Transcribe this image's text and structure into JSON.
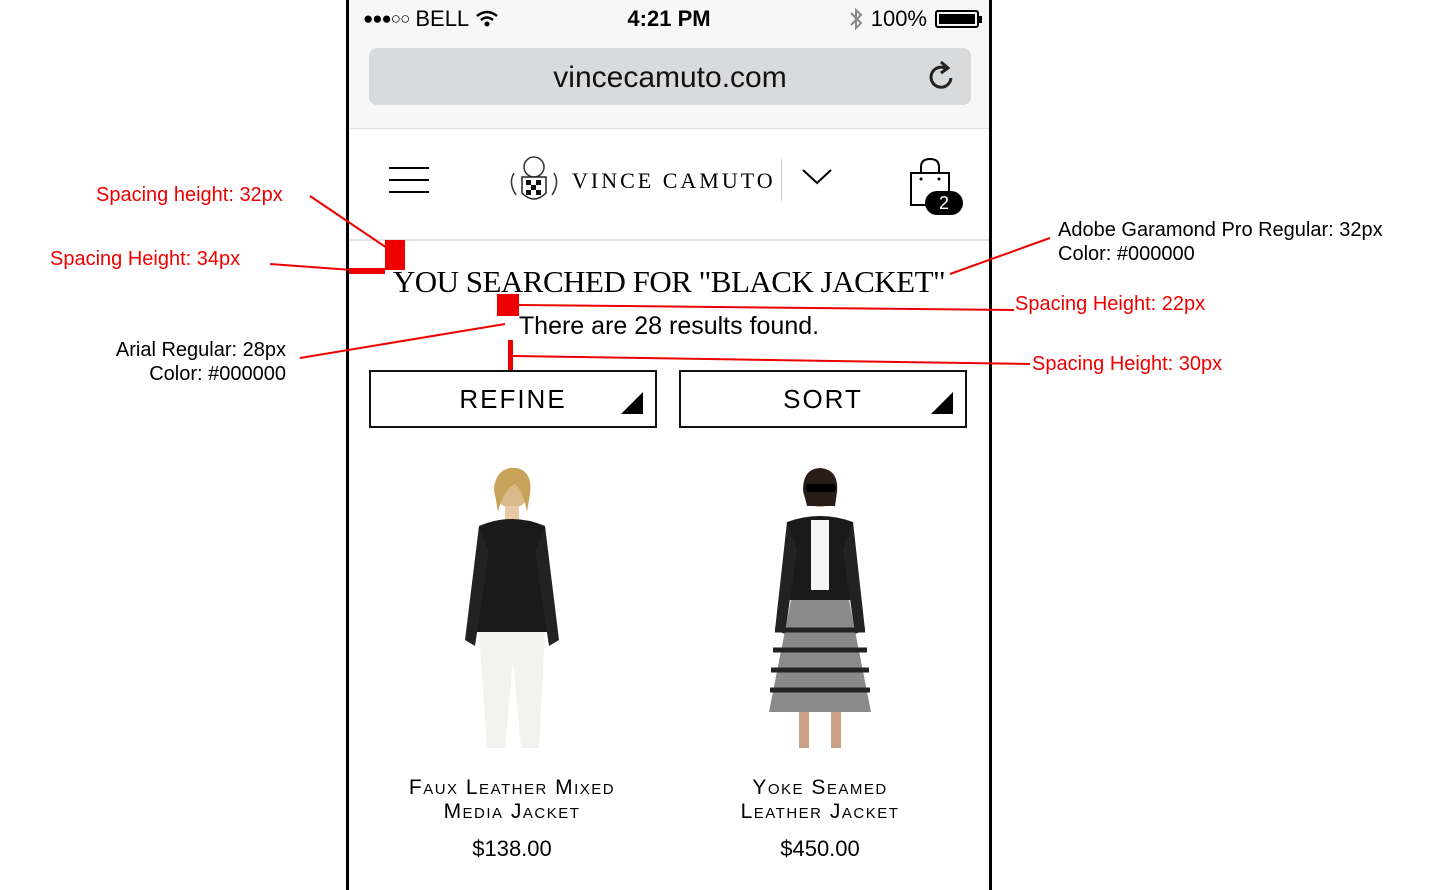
{
  "status_bar": {
    "carrier": "BELL",
    "signal_dots": "●●●○○",
    "time": "4:21 PM",
    "battery": "100%"
  },
  "browser": {
    "url": "vincecamuto.com"
  },
  "header": {
    "brand": "VINCE CAMUTO",
    "cart_count": "2"
  },
  "search": {
    "title": "YOU SEARCHED FOR \"BLACK JACKET\"",
    "count_text": "There are 28 results found."
  },
  "controls": {
    "refine_label": "REFINE",
    "sort_label": "SORT"
  },
  "products": [
    {
      "name_line1": "Faux Leather Mixed",
      "name_line2": "Media Jacket",
      "price": "$138.00"
    },
    {
      "name_line1": "Yoke Seamed",
      "name_line2": "Leather Jacket",
      "price": "$450.00"
    }
  ],
  "annotations": {
    "spacing_top": "Spacing height: 32px",
    "spacing_left": "Spacing Height: 34px",
    "spacing_22": "Spacing Height: 22px",
    "spacing_30": "Spacing Height: 30px",
    "title_font_line1": "Adobe Garamond Pro Regular: 32px",
    "title_font_line2": "Color: #000000",
    "body_font_line1": "Arial Regular: 28px",
    "body_font_line2": "Color: #000000"
  },
  "colors": {
    "annotation": "#e00000",
    "urlbar": "#d9dadb",
    "text": "#000000"
  }
}
